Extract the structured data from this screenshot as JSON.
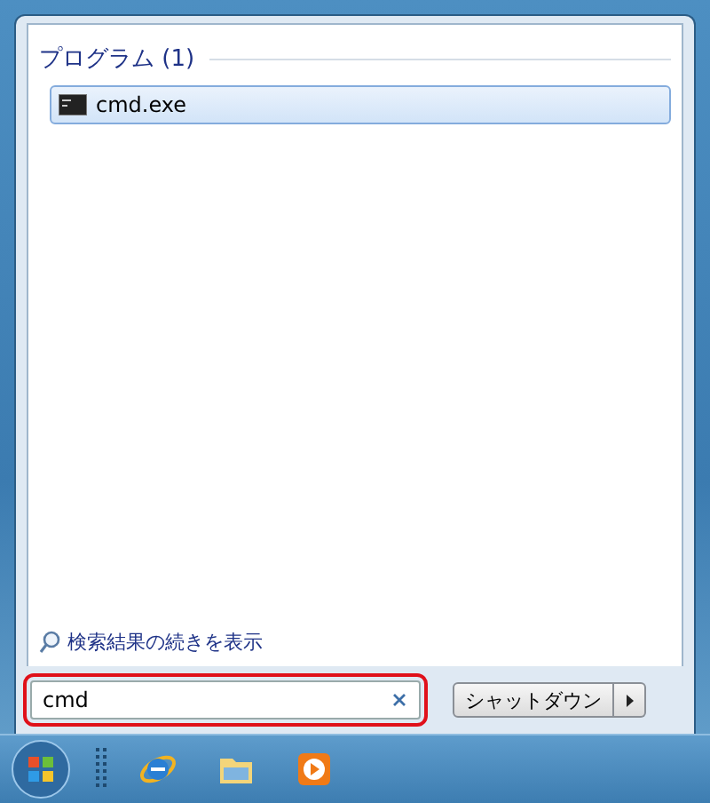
{
  "results": {
    "heading": "プログラム (1)",
    "items": [
      {
        "label": "cmd.exe",
        "selected": true
      }
    ]
  },
  "more_results": "検索結果の続きを表示",
  "search": {
    "value": "cmd",
    "highlighted": true
  },
  "shutdown": {
    "label": "シャットダウン"
  },
  "taskbar": {
    "items": [
      {
        "kind": "grip"
      },
      {
        "kind": "browser"
      },
      {
        "kind": "folder"
      },
      {
        "kind": "media"
      }
    ]
  }
}
